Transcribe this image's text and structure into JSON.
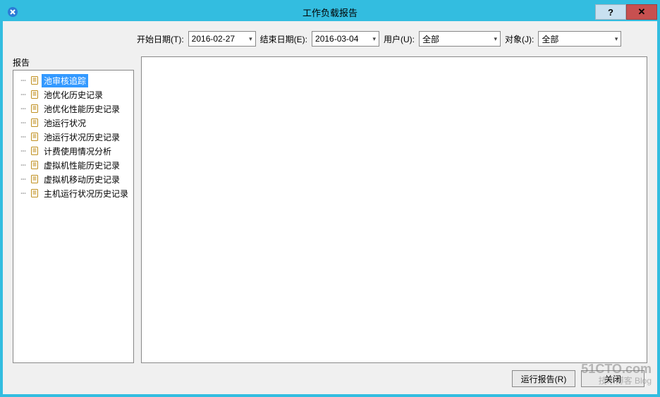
{
  "window": {
    "title": "工作负载报告",
    "help_symbol": "?",
    "close_symbol": "✕"
  },
  "filters": {
    "start_label": "开始日期(T):",
    "start_value": "2016-02-27",
    "end_label": "结束日期(E):",
    "end_value": "2016-03-04",
    "user_label": "用户(U):",
    "user_value": "全部",
    "object_label": "对象(J):",
    "object_value": "全部"
  },
  "tree": {
    "heading": "报告",
    "items": [
      {
        "label": "池审核追踪",
        "selected": true
      },
      {
        "label": "池优化历史记录",
        "selected": false
      },
      {
        "label": "池优化性能历史记录",
        "selected": false
      },
      {
        "label": "池运行状况",
        "selected": false
      },
      {
        "label": "池运行状况历史记录",
        "selected": false
      },
      {
        "label": "计费使用情况分析",
        "selected": false
      },
      {
        "label": "虚拟机性能历史记录",
        "selected": false
      },
      {
        "label": "虚拟机移动历史记录",
        "selected": false
      },
      {
        "label": "主机运行状况历史记录",
        "selected": false
      }
    ]
  },
  "buttons": {
    "run": "运行报告(R)",
    "close": "关闭"
  },
  "watermark": {
    "main": "51CTO.com",
    "sub": "技术博客  Blog"
  }
}
